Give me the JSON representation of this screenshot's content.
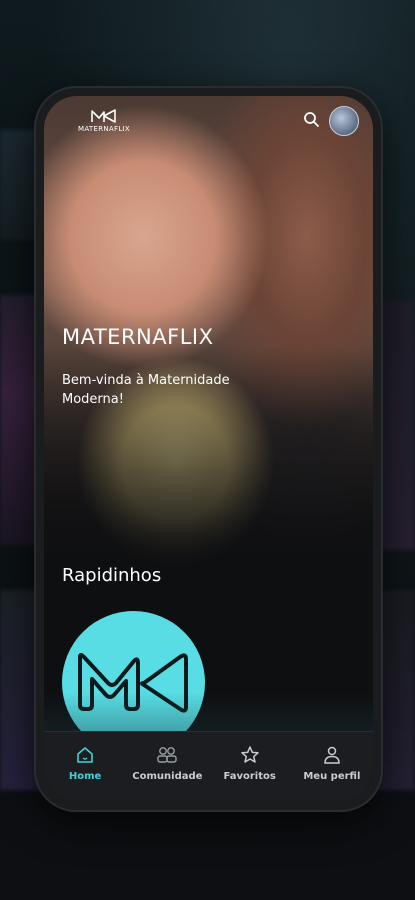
{
  "app": {
    "logo_text": "MATERNAFLIX"
  },
  "hero": {
    "title": "MATERNAFLIX",
    "subtitle": "Bem-vinda à Maternidade Moderna!"
  },
  "sections": {
    "shorts_title": "Rapidinhos"
  },
  "nav": {
    "items": [
      {
        "label": "Home",
        "icon": "home-icon",
        "active": true
      },
      {
        "label": "Comunidade",
        "icon": "community-icon",
        "active": false
      },
      {
        "label": "Favoritos",
        "icon": "star-icon",
        "active": false
      },
      {
        "label": "Meu perfil",
        "icon": "profile-icon",
        "active": false
      }
    ]
  },
  "colors": {
    "accent": "#3fd3d8",
    "card": "#57dde3",
    "nav_bg": "#1b1d20"
  }
}
